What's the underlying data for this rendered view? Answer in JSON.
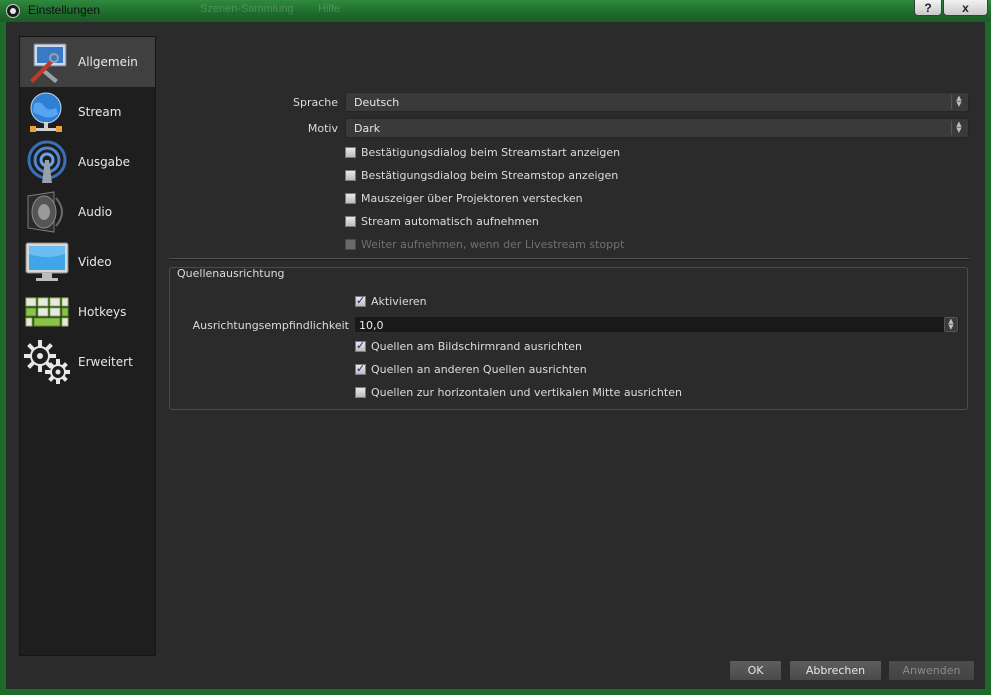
{
  "window": {
    "title": "Einstellungen",
    "ghost_tabs": [
      "Szenen-Sammlung",
      "Hilfe"
    ],
    "help_button": "?",
    "close_button": "x"
  },
  "sidebar": {
    "items": [
      {
        "label": "Allgemein",
        "icon": "general-tools-icon",
        "active": true
      },
      {
        "label": "Stream",
        "icon": "globe-network-icon",
        "active": false
      },
      {
        "label": "Ausgabe",
        "icon": "antenna-icon",
        "active": false
      },
      {
        "label": "Audio",
        "icon": "speaker-icon",
        "active": false
      },
      {
        "label": "Video",
        "icon": "monitor-icon",
        "active": false
      },
      {
        "label": "Hotkeys",
        "icon": "keyboard-icon",
        "active": false
      },
      {
        "label": "Erweitert",
        "icon": "gears-icon",
        "active": false
      }
    ]
  },
  "general": {
    "language_label": "Sprache",
    "language_value": "Deutsch",
    "theme_label": "Motiv",
    "theme_value": "Dark",
    "checkboxes": [
      {
        "label": "Bestätigungsdialog beim Streamstart anzeigen",
        "checked": false,
        "disabled": false
      },
      {
        "label": "Bestätigungsdialog beim Streamstop anzeigen",
        "checked": false,
        "disabled": false
      },
      {
        "label": "Mauszeiger über Projektoren verstecken",
        "checked": false,
        "disabled": false
      },
      {
        "label": "Stream automatisch aufnehmen",
        "checked": false,
        "disabled": false
      },
      {
        "label": "Weiter aufnehmen, wenn der Livestream stoppt",
        "checked": false,
        "disabled": true
      }
    ]
  },
  "snapping": {
    "group_title": "Quellenausrichtung",
    "enable_label": "Aktivieren",
    "enable_checked": true,
    "sensitivity_label": "Ausrichtungsempfindlichkeit",
    "sensitivity_value": "10,0",
    "options": [
      {
        "label": "Quellen am Bildschirmrand ausrichten",
        "checked": true
      },
      {
        "label": "Quellen an anderen Quellen ausrichten",
        "checked": true
      },
      {
        "label": "Quellen zur horizontalen und vertikalen Mitte ausrichten",
        "checked": false
      }
    ]
  },
  "buttons": {
    "ok": "OK",
    "cancel": "Abbrechen",
    "apply": "Anwenden"
  },
  "colors": {
    "titlebar": "#1e6b2c",
    "background": "#2b2b2b",
    "sidebar": "#1e1e1e",
    "sidebar_active": "#404040"
  }
}
